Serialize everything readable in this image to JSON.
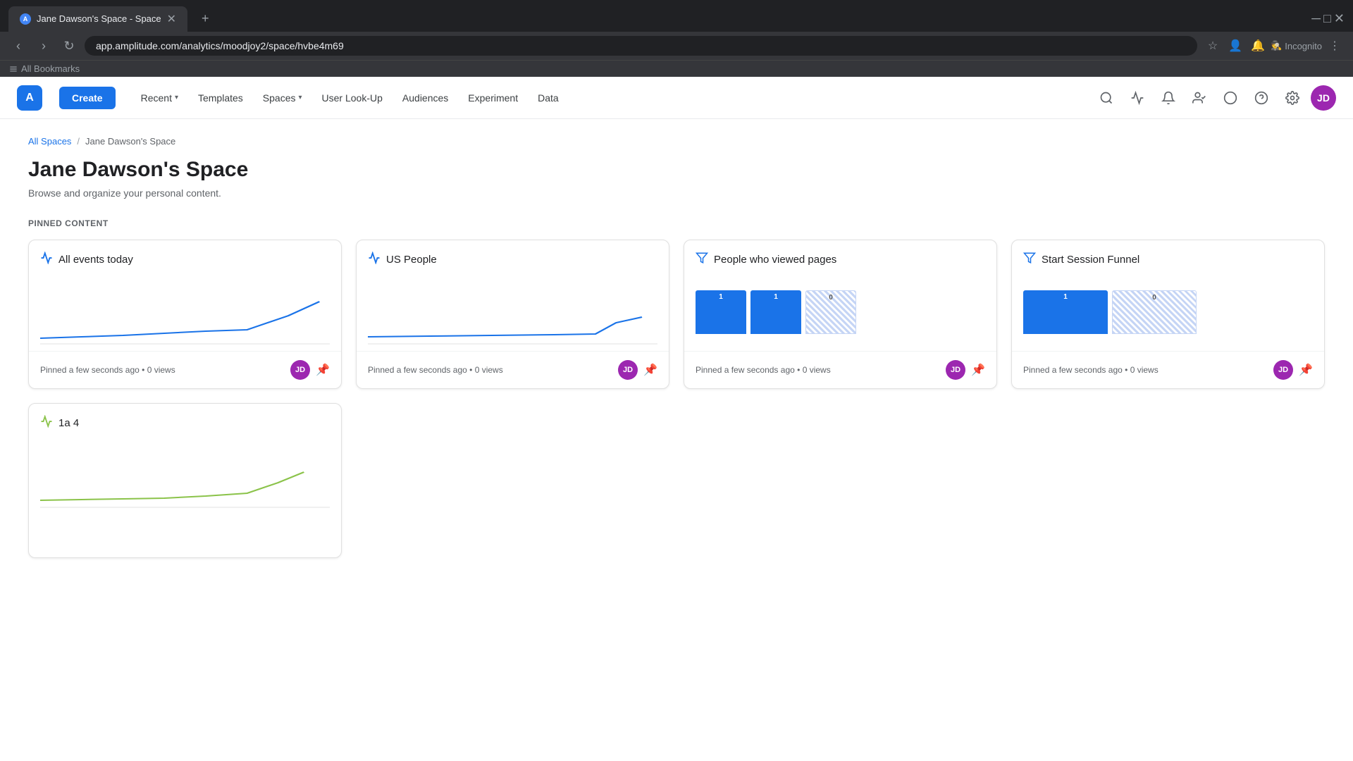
{
  "browser": {
    "tab_title": "Jane Dawson's Space - Space",
    "url": "app.amplitude.com/analytics/moodjoy2/space/hvbe4m69",
    "incognito_label": "Incognito",
    "bookmarks_label": "All Bookmarks"
  },
  "nav": {
    "logo_text": "A",
    "create_label": "Create",
    "items": [
      {
        "label": "Recent",
        "has_chevron": true
      },
      {
        "label": "Templates",
        "has_chevron": false
      },
      {
        "label": "Spaces",
        "has_chevron": true
      },
      {
        "label": "User Look-Up",
        "has_chevron": false
      },
      {
        "label": "Audiences",
        "has_chevron": false
      },
      {
        "label": "Experiment",
        "has_chevron": false
      },
      {
        "label": "Data",
        "has_chevron": false
      }
    ],
    "user_initials": "JD"
  },
  "page": {
    "breadcrumb_all": "All Spaces",
    "breadcrumb_current": "Jane Dawson's Space",
    "title": "Jane Dawson's Space",
    "subtitle": "Browse and organize your personal content.",
    "section_label": "PINNED CONTENT"
  },
  "cards": [
    {
      "id": "all-events-today",
      "title": "All events today",
      "icon_type": "line-chart",
      "chart_type": "line-blue",
      "pinned_text": "Pinned",
      "time_text": "a few seconds ago",
      "views": "0 views",
      "owner_initials": "JD"
    },
    {
      "id": "us-people",
      "title": "US People",
      "icon_type": "line-chart",
      "chart_type": "line-blue-flat",
      "pinned_text": "Pinned",
      "time_text": "a few seconds ago",
      "views": "0 views",
      "owner_initials": "JD"
    },
    {
      "id": "people-viewed-pages",
      "title": "People who viewed pages",
      "icon_type": "funnel",
      "chart_type": "funnel-3bar",
      "pinned_text": "Pinned",
      "time_text": "a few seconds ago",
      "views": "0 views",
      "owner_initials": "JD"
    },
    {
      "id": "start-session-funnel",
      "title": "Start Session Funnel",
      "icon_type": "funnel",
      "chart_type": "funnel-2bar",
      "pinned_text": "Pinned",
      "time_text": "a few seconds ago",
      "views": "0 views",
      "owner_initials": "JD"
    }
  ],
  "card_second_row": [
    {
      "id": "1a4",
      "title": "1a 4",
      "icon_type": "line-chart-green",
      "chart_type": "line-green"
    }
  ],
  "separator": "•"
}
